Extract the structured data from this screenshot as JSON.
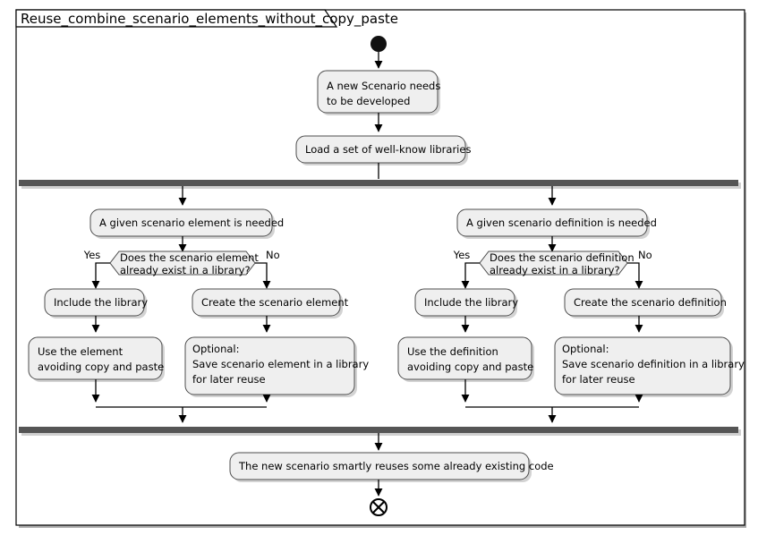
{
  "diagram": {
    "kind": "uml-activity-diagram",
    "title": "Reuse_combine_scenario_elements_without_copy_paste",
    "colors": {
      "activity_fill": "#efefef",
      "activity_border": "#4d4d4d",
      "bar_fill": "#555555",
      "edge": "#000000",
      "frame_border": "#000000",
      "canvas": "#ffffff"
    },
    "nodes": {
      "start": {
        "type": "initial-node",
        "label": ""
      },
      "activity_new_scenario": {
        "type": "activity",
        "lines": [
          "A new Scenario needs",
          "to be developed"
        ]
      },
      "activity_load_libraries": {
        "type": "activity",
        "lines": [
          "Load a set of well-know libraries"
        ]
      },
      "fork_bar": {
        "type": "fork-node",
        "label": ""
      },
      "activity_element_needed": {
        "type": "activity",
        "lines": [
          "A given scenario element is needed"
        ]
      },
      "decision_element": {
        "type": "decision",
        "lines": [
          "Does the scenario element",
          "already exist in a library?"
        ],
        "guard_yes": "Yes",
        "guard_no": "No"
      },
      "activity_include_library_left": {
        "type": "activity",
        "lines": [
          "Include the library"
        ]
      },
      "activity_create_element": {
        "type": "activity",
        "lines": [
          "Create the scenario element"
        ]
      },
      "activity_use_element": {
        "type": "activity",
        "lines": [
          "Use the element",
          "avoiding copy and paste"
        ]
      },
      "activity_save_element": {
        "type": "activity",
        "lines": [
          "Optional:",
          "Save scenario element in a library",
          "for later reuse"
        ]
      },
      "activity_definition_needed": {
        "type": "activity",
        "lines": [
          "A given scenario definition is needed"
        ]
      },
      "decision_definition": {
        "type": "decision",
        "lines": [
          "Does the scenario definition",
          "already exist in a library?"
        ],
        "guard_yes": "Yes",
        "guard_no": "No"
      },
      "activity_include_library_right": {
        "type": "activity",
        "lines": [
          "Include the library"
        ]
      },
      "activity_create_definition": {
        "type": "activity",
        "lines": [
          "Create the scenario definition"
        ]
      },
      "activity_use_definition": {
        "type": "activity",
        "lines": [
          "Use the definition",
          "avoiding copy and paste"
        ]
      },
      "activity_save_definition": {
        "type": "activity",
        "lines": [
          "Optional:",
          "Save scenario definition in a library",
          "for later reuse"
        ]
      },
      "join_bar": {
        "type": "join-node",
        "label": ""
      },
      "activity_final_summary": {
        "type": "activity",
        "lines": [
          "The new scenario smartly reuses some already existing code"
        ]
      },
      "end": {
        "type": "final-node",
        "label": ""
      }
    }
  }
}
